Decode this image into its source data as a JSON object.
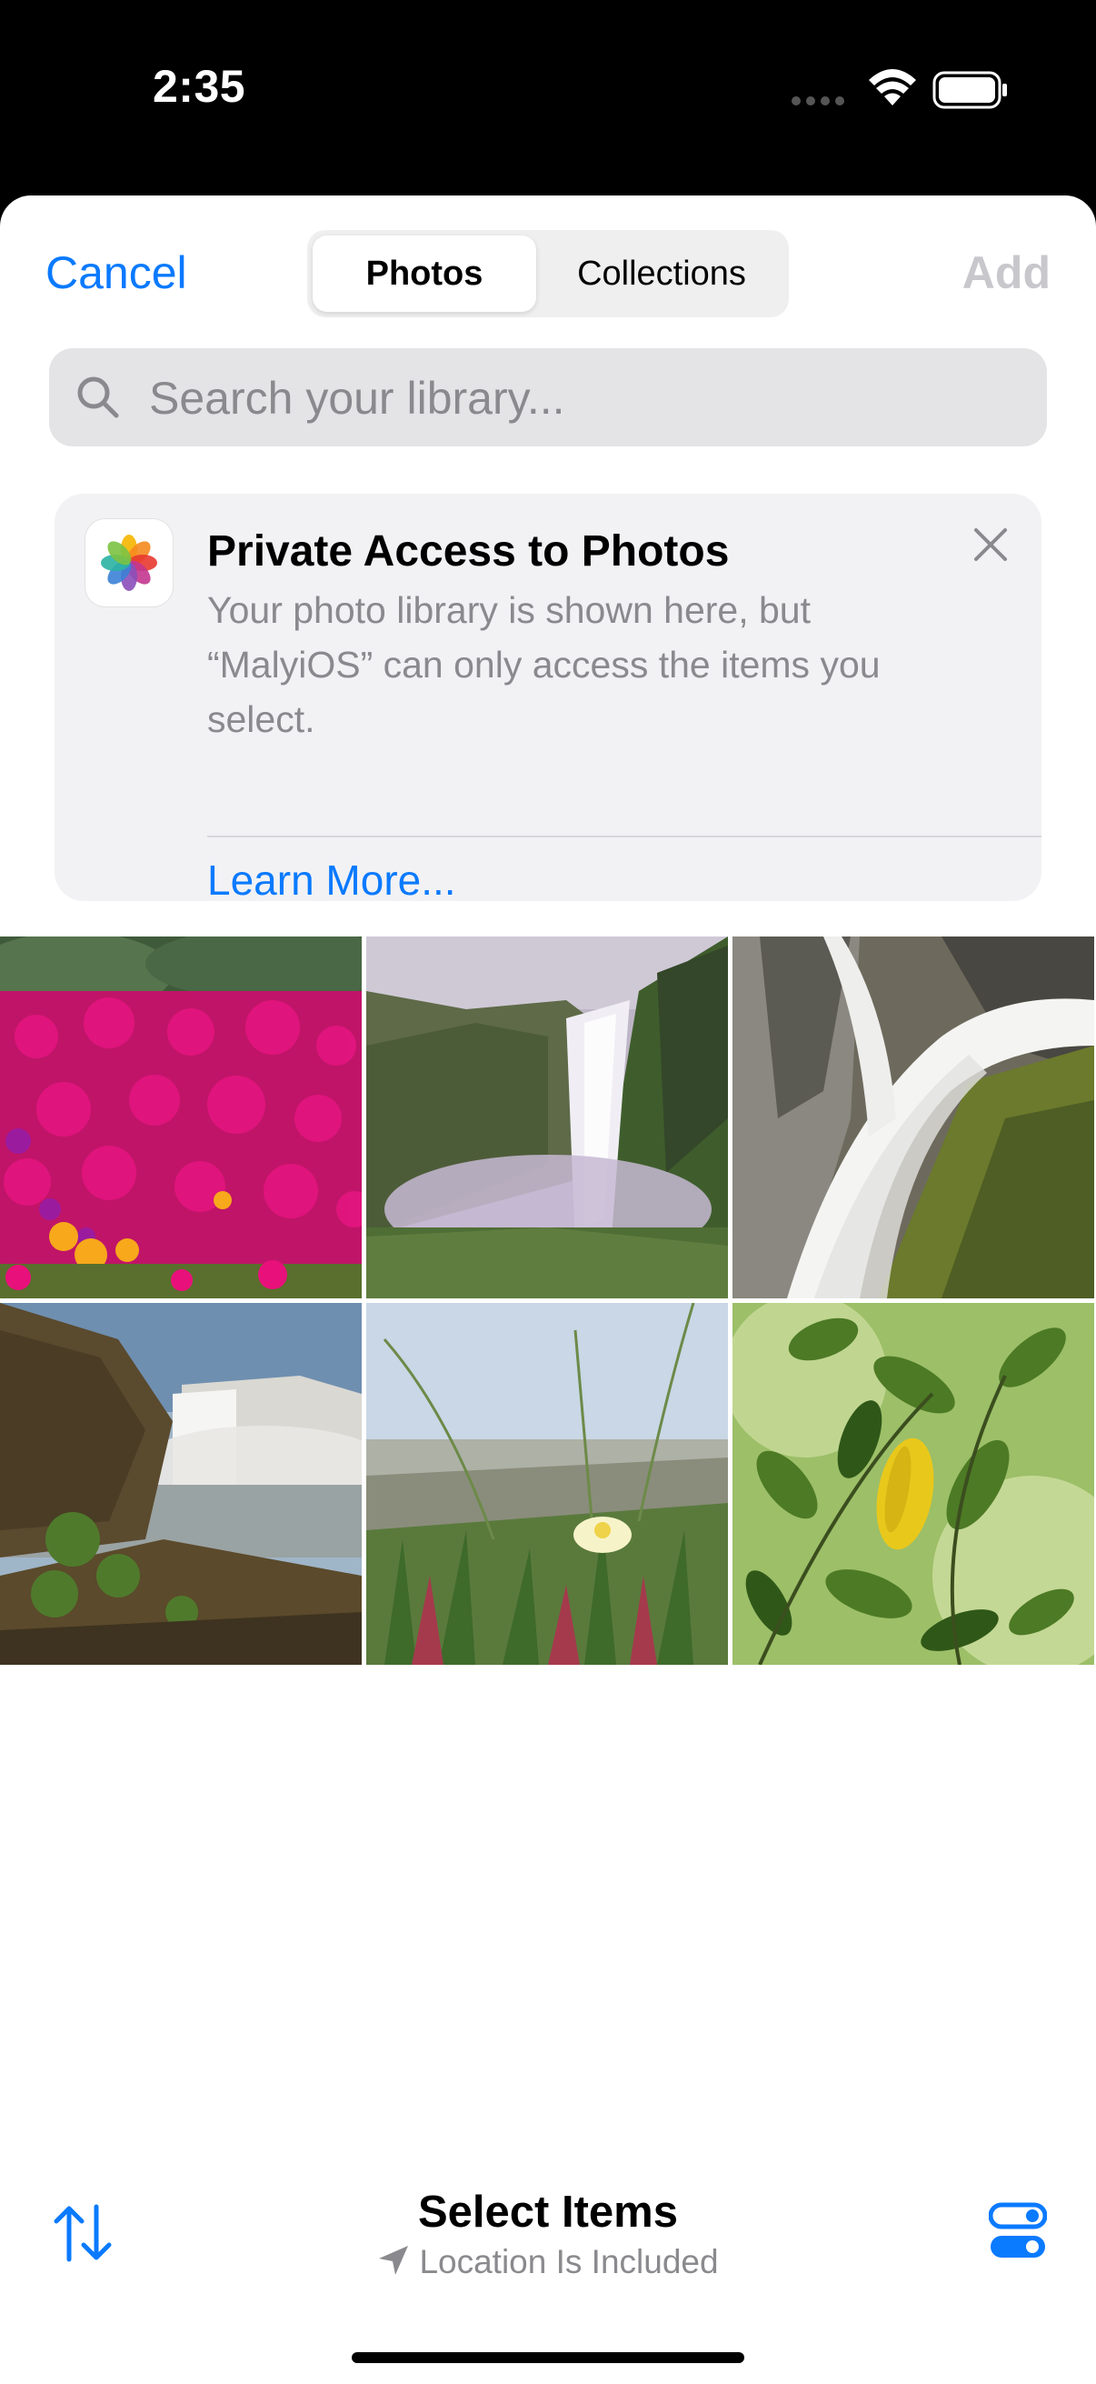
{
  "status_bar": {
    "time": "2:35"
  },
  "header": {
    "cancel_label": "Cancel",
    "add_label": "Add",
    "tabs": [
      {
        "label": "Photos",
        "selected": true
      },
      {
        "label": "Collections",
        "selected": false
      }
    ]
  },
  "search": {
    "placeholder": "Search your library..."
  },
  "privacy_card": {
    "title": "Private Access to Photos",
    "body": "Your photo library is shown here, but “MalyiOS” can only access the items you select.",
    "link": "Learn More..."
  },
  "photos": [
    {
      "icon": "flowers-photo"
    },
    {
      "icon": "waterfall-cliff-photo"
    },
    {
      "icon": "waterfall-rocks-photo"
    },
    {
      "icon": "waterfall-coast-photo"
    },
    {
      "icon": "beach-flower-photo"
    },
    {
      "icon": "green-leaves-photo"
    }
  ],
  "bottom_bar": {
    "title": "Select Items",
    "subtitle": "Location Is Included"
  },
  "colors": {
    "accent": "#0a7aff",
    "disabled": "#c7c7cc",
    "secondary_text": "#8a8a8e"
  }
}
